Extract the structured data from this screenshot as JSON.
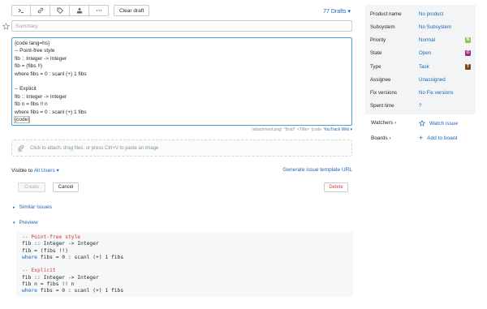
{
  "toolbar": {
    "buttons": [
      {
        "icon": "terminal-icon"
      },
      {
        "icon": "link-icon"
      },
      {
        "icon": "tag-icon"
      },
      {
        "icon": "user-stamp-icon"
      },
      {
        "icon": "more-icon"
      }
    ],
    "clear_draft": "Clear draft",
    "drafts": "77 Drafts ▾"
  },
  "summary": {
    "placeholder": "Summary"
  },
  "editor": {
    "lines": [
      "{code lang=hs}",
      "-- Point-free style",
      "fib :: Integer -> Integer",
      "fib = (fibs !!)",
      "where fibs = 0 : scanl (+) 1 fibs",
      "",
      "-- Explicit",
      "fib :: Integer -> Integer",
      "fib n = fibs !! n",
      "where fibs = 0 : scanl (+) 1 fibs",
      "{code}"
    ]
  },
  "hint": {
    "attachment": "!attachment.png!",
    "bold": "*Bold*",
    "title": "<Title>",
    "code": "{code",
    "wiki": "YouTrack Wiki ▾"
  },
  "attach": {
    "text": "Click to attach, drag files, or press Ctrl+V to paste an image"
  },
  "visibility": {
    "label": "Visible to",
    "value": "All Users ▾"
  },
  "template_link": "Generate issue template URL",
  "buttons": {
    "create": "Create",
    "cancel": "Cancel",
    "delete": "Delete"
  },
  "sections": {
    "similar": "Similar Issues",
    "preview": "Preview"
  },
  "preview": {
    "lines": [
      [
        {
          "t": "-- Point-free style",
          "c": "comment"
        }
      ],
      [
        {
          "t": "fib :: Integer -> Integer",
          "c": ""
        }
      ],
      [
        {
          "t": "fib = (fibs !!)",
          "c": ""
        }
      ],
      [
        {
          "t": "where",
          "c": "kw"
        },
        {
          "t": " fibs = 0 : scanl (+) 1 fibs",
          "c": ""
        }
      ],
      [
        {
          "t": "",
          "c": ""
        }
      ],
      [
        {
          "t": "-- Explicit",
          "c": "comment"
        }
      ],
      [
        {
          "t": "fib :: Integer -> Integer",
          "c": ""
        }
      ],
      [
        {
          "t": "fib n = fibs !! n",
          "c": ""
        }
      ],
      [
        {
          "t": "where",
          "c": "kw"
        },
        {
          "t": " fibs = 0 : scanl (+) 1 fibs",
          "c": ""
        }
      ]
    ]
  },
  "fields": [
    {
      "key": "Product name",
      "value": "No product",
      "chip": null
    },
    {
      "key": "Subsystem",
      "value": "No Subsystem",
      "chip": null
    },
    {
      "key": "Priority",
      "value": "Normal",
      "chip": {
        "letter": "N",
        "color": "#8ac74a"
      }
    },
    {
      "key": "State",
      "value": "Open",
      "chip": {
        "letter": "O",
        "color": "#9b2b7d"
      }
    },
    {
      "key": "Type",
      "value": "Task",
      "chip": {
        "letter": "T",
        "color": "#7a4a10"
      }
    },
    {
      "key": "Assignee",
      "value": "Unassigned",
      "chip": null
    },
    {
      "key": "Fix versions",
      "value": "No Fix versions",
      "chip": null
    },
    {
      "key": "Spent time",
      "value": "?",
      "chip": null
    }
  ],
  "watchers": {
    "label": "Watchers ›",
    "action": "Watch issue"
  },
  "boards": {
    "label": "Boards ›",
    "action": "Add to board"
  }
}
